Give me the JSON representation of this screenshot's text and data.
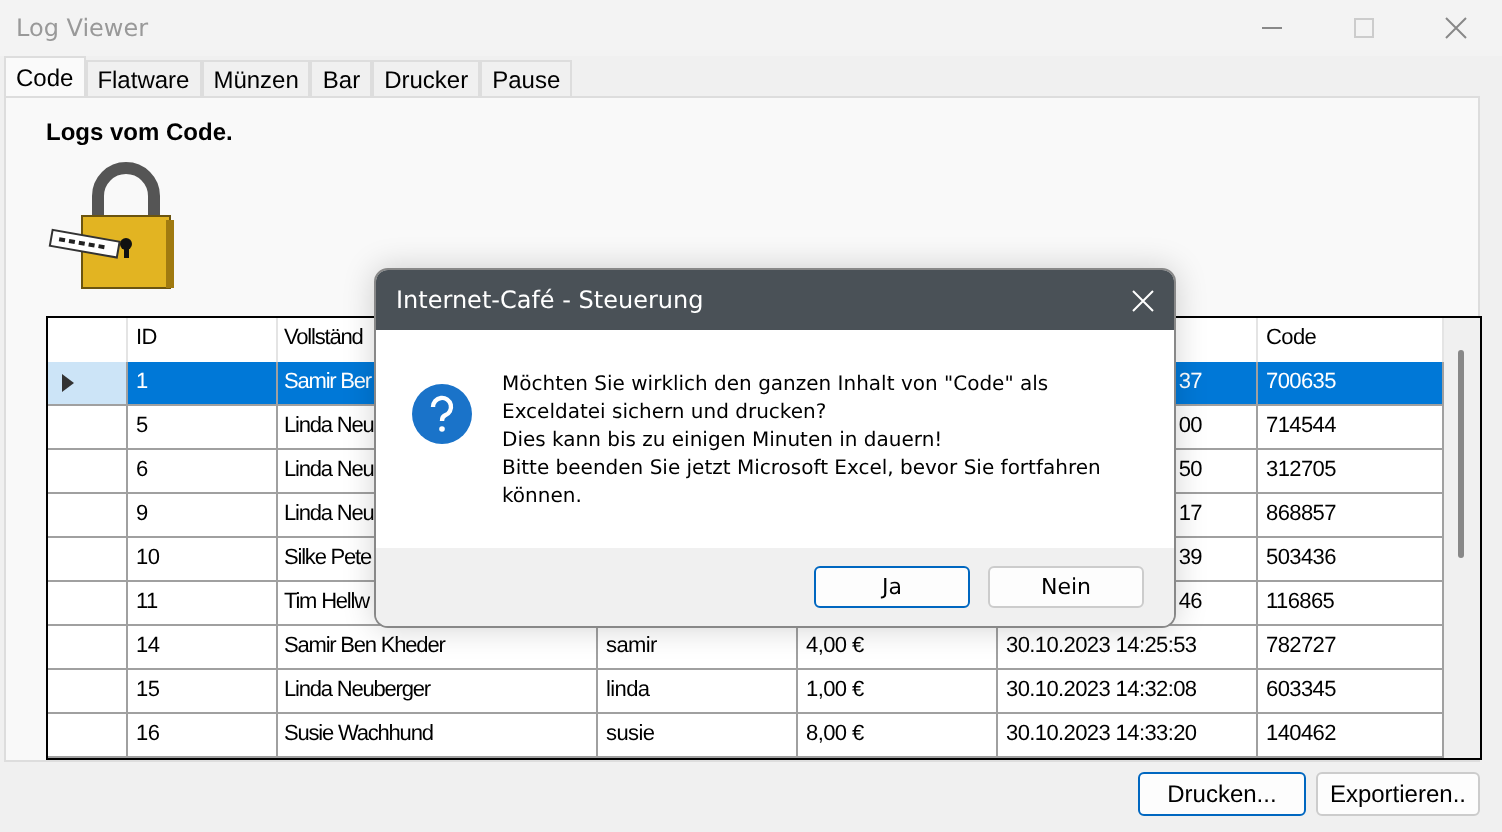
{
  "window": {
    "title": "Log Viewer"
  },
  "tabs": [
    {
      "label": "Code",
      "selected": true
    },
    {
      "label": "Flatware",
      "selected": false
    },
    {
      "label": "Münzen",
      "selected": false
    },
    {
      "label": "Bar",
      "selected": false
    },
    {
      "label": "Drucker",
      "selected": false
    },
    {
      "label": "Pause",
      "selected": false
    }
  ],
  "heading": "Logs vom Code.",
  "table": {
    "columns": [
      "ID",
      "Vollständ",
      "",
      "",
      "",
      "Code"
    ],
    "rows": [
      {
        "selected": true,
        "covered": true,
        "id": "1",
        "name": "Samir Ber",
        "column_3": "",
        "column_4": "",
        "column_5": "37",
        "code": "700635"
      },
      {
        "selected": false,
        "covered": true,
        "id": "5",
        "name": "Linda Neu",
        "column_3": "",
        "column_4": "",
        "column_5": "00",
        "code": "714544"
      },
      {
        "selected": false,
        "covered": true,
        "id": "6",
        "name": "Linda Neu",
        "column_3": "",
        "column_4": "",
        "column_5": "50",
        "code": "312705"
      },
      {
        "selected": false,
        "covered": true,
        "id": "9",
        "name": "Linda Neu",
        "column_3": "",
        "column_4": "",
        "column_5": "17",
        "code": "868857"
      },
      {
        "selected": false,
        "covered": true,
        "id": "10",
        "name": "Silke Pete",
        "column_3": "",
        "column_4": "",
        "column_5": "39",
        "code": "503436"
      },
      {
        "selected": false,
        "covered": true,
        "id": "11",
        "name": "Tim Hellw",
        "column_3": "",
        "column_4": "",
        "column_5": "46",
        "code": "116865"
      },
      {
        "selected": false,
        "covered": false,
        "id": "14",
        "name": "Samir Ben Kheder",
        "column_3": "samir",
        "column_4": "4,00 €",
        "column_5": "30.10.2023 14:25:53",
        "code": "782727"
      },
      {
        "selected": false,
        "covered": false,
        "id": "15",
        "name": "Linda Neuberger",
        "column_3": "linda",
        "column_4": "1,00 €",
        "column_5": "30.10.2023 14:32:08",
        "code": "603345"
      },
      {
        "selected": false,
        "covered": false,
        "id": "16",
        "name": "Susie Wachhund",
        "column_3": "susie",
        "column_4": "8,00 €",
        "column_5": "30.10.2023 14:33:20",
        "code": "140462"
      }
    ]
  },
  "buttons": [
    "Drucken...",
    "Exportieren.."
  ],
  "dialog": {
    "title": "Internet-Café - Steuerung",
    "message_lines": [
      "Möchten Sie wirklich den ganzen Inhalt von \"Code\" als",
      "Exceldatei sichern und drucken?",
      "Dies kann bis zu einigen Minuten in dauern!",
      "Bitte beenden Sie jetzt Microsoft Excel, bevor Sie fortfahren",
      "können."
    ],
    "buttons": [
      {
        "label": "Ja",
        "default": true
      },
      {
        "label": "Nein",
        "default": false
      }
    ]
  }
}
